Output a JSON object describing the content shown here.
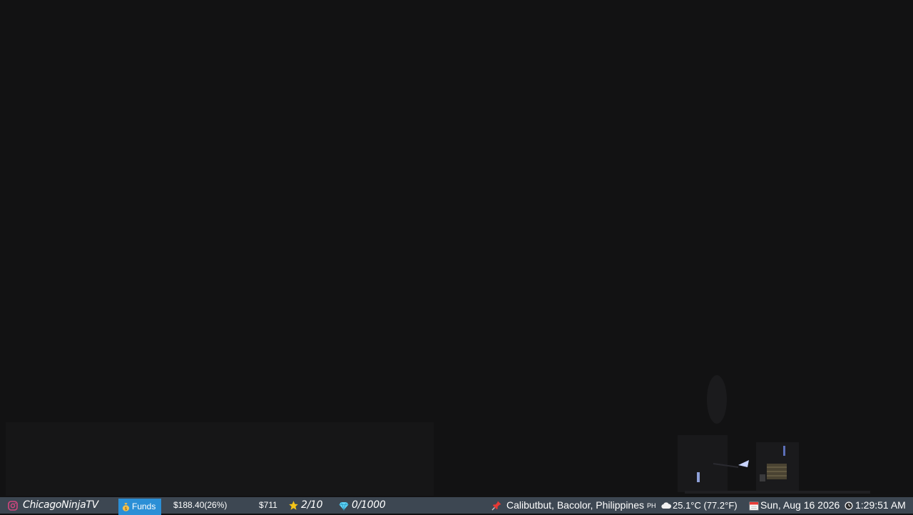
{
  "stream": {
    "channel_name": "ChicagoNinjaTV",
    "funds_label": "Funds",
    "funds_amount": "$188.40(26%)",
    "goal_amount": "$711",
    "stars": "2/10",
    "gems": "0/1000",
    "location": "Calibutbut, Bacolor, Philippines",
    "country_code": "PH",
    "weather": "25.1°C (77.2°F)",
    "date": "Sun, Aug 16 2026",
    "time": "1:29:51 AM"
  },
  "icons": {
    "instagram": "instagram-icon",
    "money_bag": "money-bag-icon",
    "star": "star-icon",
    "gem": "gem-icon",
    "pin": "pushpin-icon",
    "weather": "cloud-icon",
    "calendar": "calendar-icon",
    "clock": "clock-icon"
  },
  "colors": {
    "bar_background": "#3d4752",
    "funds_accent": "#2b8fd6",
    "instagram": "#d4457f",
    "star": "#f5c518",
    "gem": "#5fd1f5",
    "pin": "#e53935"
  }
}
